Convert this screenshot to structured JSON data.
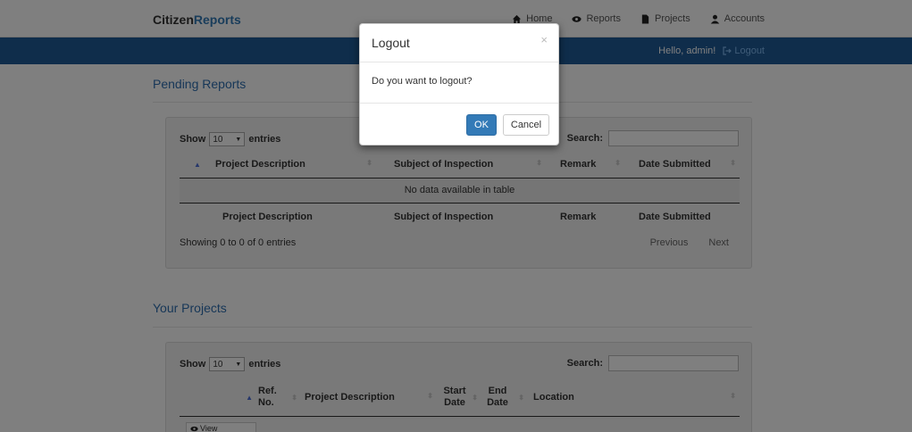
{
  "brand": {
    "part1": "Citizen",
    "part2": "Reports"
  },
  "nav": [
    {
      "label": "Home",
      "icon": "home-icon"
    },
    {
      "label": "Reports",
      "icon": "eye-icon"
    },
    {
      "label": "Projects",
      "icon": "file-icon"
    },
    {
      "label": "Accounts",
      "icon": "user-icon"
    }
  ],
  "greeting": "Hello, admin!",
  "logout_link": "Logout",
  "pending": {
    "title": "Pending Reports",
    "show_label": "Show",
    "entries_value": "10",
    "entries_label": "entries",
    "search_label": "Search:",
    "columns": [
      "Project Description",
      "Subject of Inspection",
      "Remark",
      "Date Submitted"
    ],
    "empty_text": "No data available in table",
    "info": "Showing 0 to 0 of 0 entries",
    "prev": "Previous",
    "next": "Next"
  },
  "projects": {
    "title": "Your Projects",
    "show_label": "Show",
    "entries_value": "10",
    "entries_label": "entries",
    "search_label": "Search:",
    "columns": [
      "Ref. No.",
      "Project Description",
      "Start Date",
      "End Date",
      "Location"
    ],
    "row_button": "View"
  },
  "modal": {
    "title": "Logout",
    "close": "×",
    "body": "Do you want to logout?",
    "ok": "OK",
    "cancel": "Cancel"
  },
  "colors": {
    "primary": "#337ab7",
    "navbar": "#1f5a96",
    "section_title": "#2f6fb0"
  }
}
